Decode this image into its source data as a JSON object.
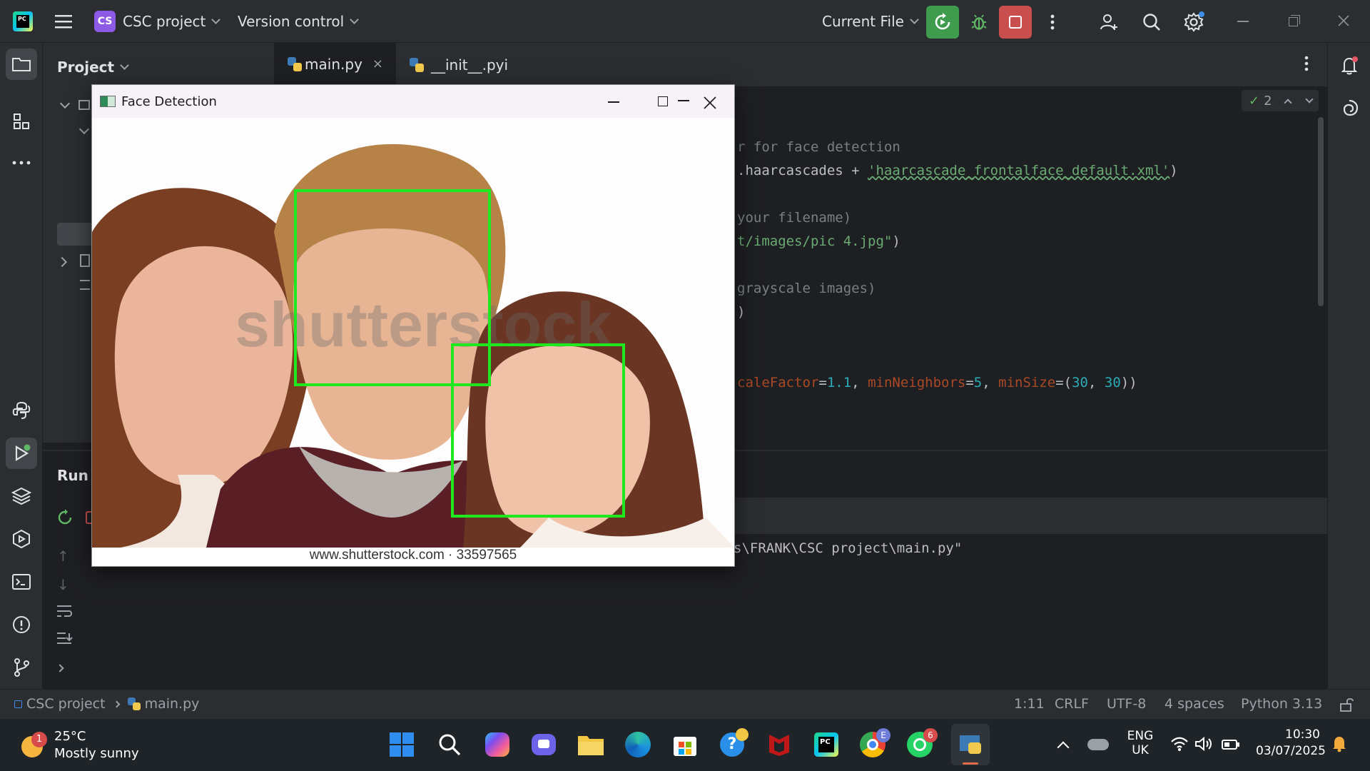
{
  "titlebar": {
    "project_badge": "CS",
    "project_name": "CSC project",
    "vcs": "Version control",
    "run_config": "Current File"
  },
  "project_panel": {
    "title": "Project"
  },
  "tabs": [
    {
      "label": "main.py",
      "active": true
    },
    {
      "label": "__init__.pyi",
      "active": false
    }
  ],
  "editor": {
    "inspection_count": "2",
    "code": {
      "l1_comment": "r for face detection",
      "l2_pre": ".haarcascades + ",
      "l2_str": "'haarcascade_frontalface_default.xml'",
      "l2_post": ")",
      "l3_comment": "your filename)",
      "l4_str": "t/images/pic 4.jpg\"",
      "l4_post": ")",
      "l5_comment": "grayscale images)",
      "l6": ")",
      "l7_kw1": "caleFactor",
      "l7_v1": "1.1",
      "l7_kw2": "minNeighbors",
      "l7_v2": "5",
      "l7_kw3": "minSize",
      "l7_v3a": "30",
      "l7_v3b": "30"
    }
  },
  "run_panel": {
    "title": "Run",
    "output": "s\\FRANK\\CSC project\\main.py\""
  },
  "statusbar": {
    "crumb_project": "CSC project",
    "crumb_file": "main.py",
    "position": "1:11",
    "line_sep": "CRLF",
    "encoding": "UTF-8",
    "indent": "4 spaces",
    "interpreter": "Python 3.13"
  },
  "face_window": {
    "title": "Face Detection",
    "watermark": "shutterstock",
    "caption": "www.shutterstock.com · 33597565"
  },
  "taskbar": {
    "weather_temp": "25°C",
    "weather_desc": "Mostly sunny",
    "weather_badge": "1",
    "lang_top": "ENG",
    "lang_bottom": "UK",
    "time": "10:30",
    "date": "03/07/2025",
    "whatsapp_badge": "6",
    "chrome_badge": "E"
  },
  "colors": {
    "accent_run": "#3f9b4e",
    "accent_stop": "#c94f4f",
    "detect_box": "#1ee81e"
  }
}
